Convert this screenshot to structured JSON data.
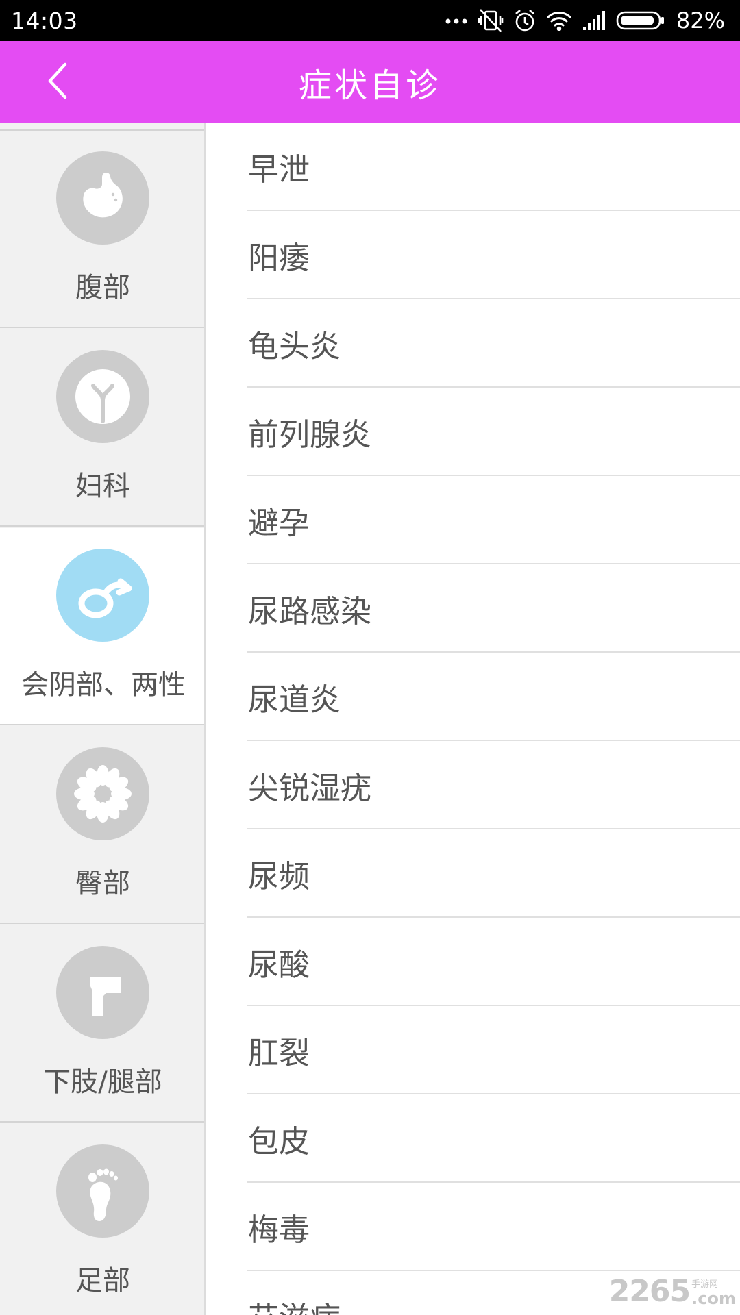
{
  "status_bar": {
    "time": "14:03",
    "battery_percent": "82%",
    "icons": [
      "more-dots-icon",
      "vibrate-off-icon",
      "alarm-icon",
      "wifi-icon",
      "signal-icon",
      "battery-icon"
    ]
  },
  "header": {
    "title": "症状自诊",
    "back_icon": "chevron-left-icon"
  },
  "colors": {
    "header_bg": "#e44cf3",
    "selected_icon_bg": "#a1dcf4",
    "icon_bg": "#cccccc",
    "sidebar_bg": "#f1f1f1",
    "text": "#555555"
  },
  "sidebar": {
    "items": [
      {
        "label": "腹部",
        "icon": "stomach-icon",
        "selected": false
      },
      {
        "label": "妇科",
        "icon": "uterus-icon",
        "selected": false
      },
      {
        "label": "会阴部、两性",
        "icon": "male-symbol-icon",
        "selected": true
      },
      {
        "label": "臀部",
        "icon": "flower-icon",
        "selected": false
      },
      {
        "label": "下肢/腿部",
        "icon": "leg-icon",
        "selected": false
      },
      {
        "label": "足部",
        "icon": "foot-icon",
        "selected": false
      }
    ]
  },
  "symptoms": {
    "items": [
      "早泄",
      "阳痿",
      "龟头炎",
      "前列腺炎",
      "避孕",
      "尿路感染",
      "尿道炎",
      "尖锐湿疣",
      "尿频",
      "尿酸",
      "肛裂",
      "包皮",
      "梅毒",
      "艾滋病"
    ]
  },
  "watermark": {
    "number": "2265",
    "cn": "手游网",
    "com": ".com"
  }
}
